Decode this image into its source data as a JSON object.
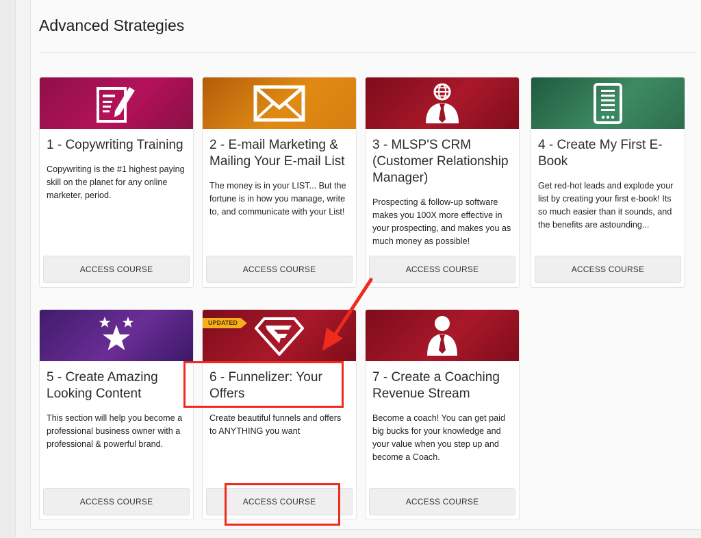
{
  "section": {
    "title": "Advanced Strategies"
  },
  "courses": [
    {
      "title": "1 - Copywriting Training",
      "description": "Copywriting is the #1 highest paying skill on the planet for any online marketer, period.",
      "button": "ACCESS COURSE",
      "icon": "document-pen-icon",
      "color": "#a3124f"
    },
    {
      "title": "2 - E-mail Marketing & Mailing Your E-mail List",
      "description": "The money is in your LIST... But the fortune is in how you manage, write to, and communicate with your List!",
      "button": "ACCESS COURSE",
      "icon": "envelope-icon",
      "color": "#d77f10"
    },
    {
      "title": "3 - MLSP'S CRM (Customer Relationship Manager)",
      "description": "Prospecting & follow-up software makes you 100X more effective in your prospecting, and makes you as much money as possible!",
      "button": "ACCESS COURSE",
      "icon": "globe-person-icon",
      "color": "#9c1526"
    },
    {
      "title": "4 - Create My First E-Book",
      "description": "Get red-hot leads and explode your list by creating your first e-book! Its so much easier than it sounds, and the benefits are astounding...",
      "button": "ACCESS COURSE",
      "icon": "ereader-icon",
      "color": "#347a56"
    },
    {
      "title": "5 - Create Amazing Looking Content",
      "description": "This section will help you become a professional business owner with a professional & powerful brand.",
      "button": "ACCESS COURSE",
      "icon": "stars-icon",
      "color": "#55247f"
    },
    {
      "title": "6 - Funnelizer: Your Offers",
      "description": "Create beautiful funnels and offers to ANYTHING you want",
      "button": "ACCESS COURSE",
      "icon": "funnelizer-logo-icon",
      "color": "#9c1526",
      "badge": "UPDATED"
    },
    {
      "title": "7 - Create a Coaching Revenue Stream",
      "description": "Become a coach! You can get paid big bucks for your knowledge and your value when you step up and become a Coach.",
      "button": "ACCESS COURSE",
      "icon": "person-tie-icon",
      "color": "#9c1526"
    }
  ],
  "annotation_color": "#ef2b1d"
}
